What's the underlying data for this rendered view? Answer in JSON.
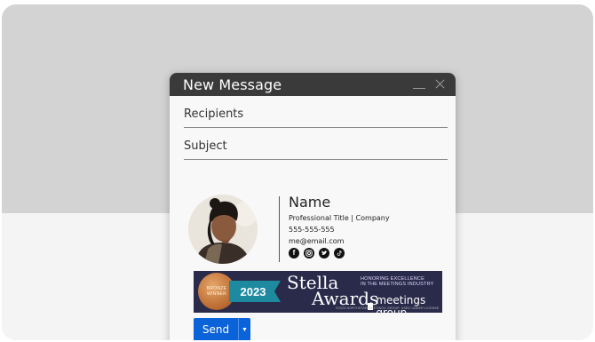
{
  "compose": {
    "title": "New Message",
    "recipients_label": "Recipients",
    "subject_label": "Subject",
    "send_label": "Send"
  },
  "signature": {
    "name": "Name",
    "title_company": "Professional Title  |  Company",
    "phone": "555-555-555",
    "email": "me@email.com",
    "social_icons": [
      "facebook-icon",
      "instagram-icon",
      "twitter-icon",
      "tiktok-icon"
    ]
  },
  "banner": {
    "medal_line1": "BRONZE",
    "medal_line2": "WINNER",
    "year": "2023",
    "award_word1": "Stella",
    "award_word2": "Awards",
    "tagline_line1": "HONORING EXCELLENCE",
    "tagline_line2": "IN THE MEETINGS INDUSTRY",
    "sponsor": "meetings group",
    "fine_print": "©2023 NORTHSTAR MEETINGS GROUP. USED UNDER LICENSE"
  },
  "colors": {
    "titlebar": "#3a3a3a",
    "send_button": "#0a63d8",
    "banner_bg": "#2a2a4a",
    "ribbon": "#1e8aa0"
  }
}
